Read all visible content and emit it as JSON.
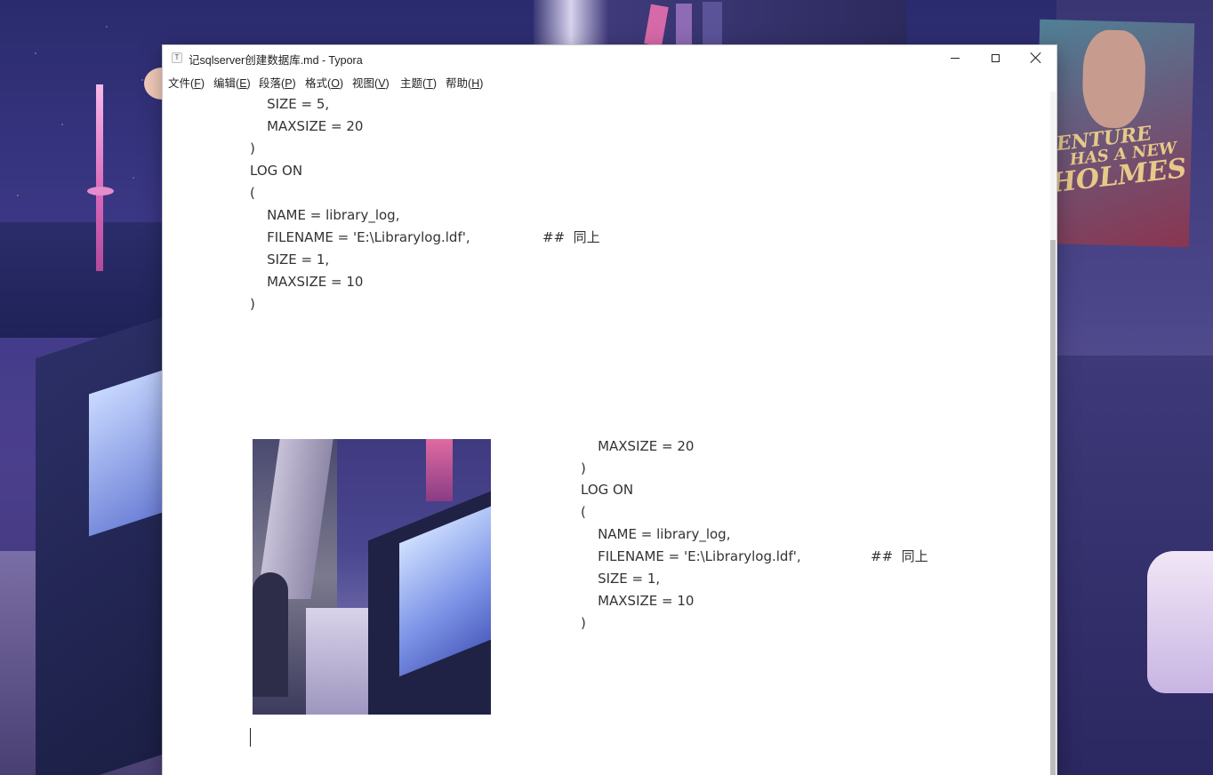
{
  "window": {
    "title": "记sqlserver创建数据库.md - Typora",
    "app_icon": "T"
  },
  "menu": [
    {
      "label": "文件",
      "key": "F"
    },
    {
      "label": "编辑",
      "key": "E"
    },
    {
      "label": "段落",
      "key": "P"
    },
    {
      "label": "格式",
      "key": "O"
    },
    {
      "label": "视图",
      "key": "V"
    },
    {
      "label": "主题",
      "key": "T"
    },
    {
      "label": "帮助",
      "key": "H"
    }
  ],
  "editor": {
    "code_top": [
      "    SIZE = 5,",
      "    MAXSIZE = 20",
      ")",
      "LOG ON",
      "(",
      "    NAME = library_log,",
      "    FILENAME = 'E:\\Librarylog.ldf',",
      "    SIZE = 1,",
      "    MAXSIZE = 10",
      ")"
    ],
    "code_top_comment": "##  同上",
    "code_right": [
      "    MAXSIZE = 20",
      ")",
      "LOG ON",
      "(",
      "    NAME = library_log,",
      "    FILENAME = 'E:\\Librarylog.ldf',",
      "    SIZE = 1,",
      "    MAXSIZE = 10",
      ")"
    ],
    "code_right_comment": "##  同上"
  },
  "poster_text": [
    "VENTURE",
    "HAS A NEW",
    "HOLMES"
  ],
  "colors": {
    "editor_text": "#333333",
    "window_bg": "#ffffff",
    "scrollbar_thumb": "#bdbdbd"
  }
}
